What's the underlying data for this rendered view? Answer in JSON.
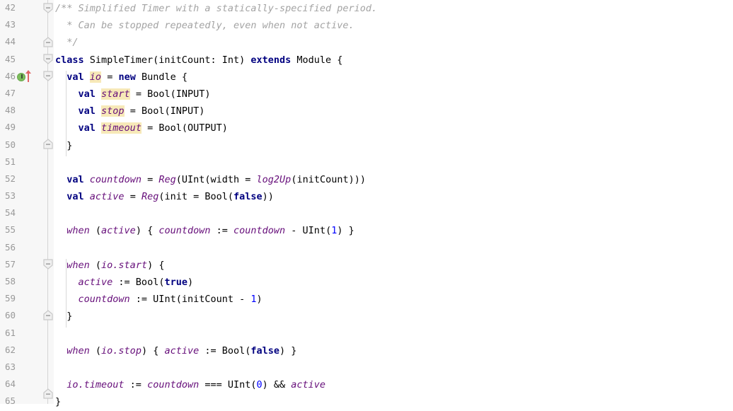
{
  "editor": {
    "language": "Scala",
    "theme": "light",
    "colors": {
      "background": "#ffffff",
      "gutter_background": "#f7f7f7",
      "line_number": "#999999",
      "keyword": "#000080",
      "comment": "#a3a3a3",
      "identifier": "#660e7a",
      "number": "#0000ff",
      "occurrence_highlight": "#f7e9b8",
      "indent_guide": "#d9d9d9",
      "fold_marker": "#c8c8c8",
      "impl_marker_green": "#7dbd5c",
      "impl_marker_arrow_red": "#e06666"
    },
    "first_line_number": 42,
    "last_line_number": 65,
    "gutter_icons": [
      {
        "line": 46,
        "name": "implementation-marker",
        "glyph": "I",
        "tooltip": "Implements member"
      },
      {
        "line": 46,
        "name": "override-arrow-icon",
        "glyph": "↑"
      }
    ],
    "fold_markers": [
      {
        "line": 42,
        "type": "expanded-start"
      },
      {
        "line": 44,
        "type": "expanded-end"
      },
      {
        "line": 45,
        "type": "expanded-start"
      },
      {
        "line": 46,
        "type": "expanded-start"
      },
      {
        "line": 50,
        "type": "expanded-end"
      },
      {
        "line": 57,
        "type": "expanded-start"
      },
      {
        "line": 60,
        "type": "expanded-end"
      },
      {
        "line": 65,
        "type": "expanded-end"
      }
    ],
    "lines": [
      {
        "n": 42,
        "text": "/** Simplified Timer with a statically-specified period."
      },
      {
        "n": 43,
        "text": "  * Can be stopped repeatedly, even when not active."
      },
      {
        "n": 44,
        "text": "  */"
      },
      {
        "n": 45,
        "text": "class SimpleTimer(initCount: Int) extends Module {"
      },
      {
        "n": 46,
        "text": "  val io = new Bundle {"
      },
      {
        "n": 47,
        "text": "    val start = Bool(INPUT)"
      },
      {
        "n": 48,
        "text": "    val stop = Bool(INPUT)"
      },
      {
        "n": 49,
        "text": "    val timeout = Bool(OUTPUT)"
      },
      {
        "n": 50,
        "text": "  }"
      },
      {
        "n": 51,
        "text": ""
      },
      {
        "n": 52,
        "text": "  val countdown = Reg(UInt(width = log2Up(initCount)))"
      },
      {
        "n": 53,
        "text": "  val active = Reg(init = Bool(false))"
      },
      {
        "n": 54,
        "text": ""
      },
      {
        "n": 55,
        "text": "  when (active) { countdown := countdown - UInt(1) }"
      },
      {
        "n": 56,
        "text": ""
      },
      {
        "n": 57,
        "text": "  when (io.start) {"
      },
      {
        "n": 58,
        "text": "    active := Bool(true)"
      },
      {
        "n": 59,
        "text": "    countdown := UInt(initCount - 1)"
      },
      {
        "n": 60,
        "text": "  }"
      },
      {
        "n": 61,
        "text": ""
      },
      {
        "n": 62,
        "text": "  when (io.stop) { active := Bool(false) }"
      },
      {
        "n": 63,
        "text": ""
      },
      {
        "n": 64,
        "text": "  io.timeout := countdown === UInt(0) && active"
      },
      {
        "n": 65,
        "text": "}"
      }
    ],
    "highlighted_occurrences": [
      "io",
      "start",
      "stop",
      "timeout"
    ]
  }
}
